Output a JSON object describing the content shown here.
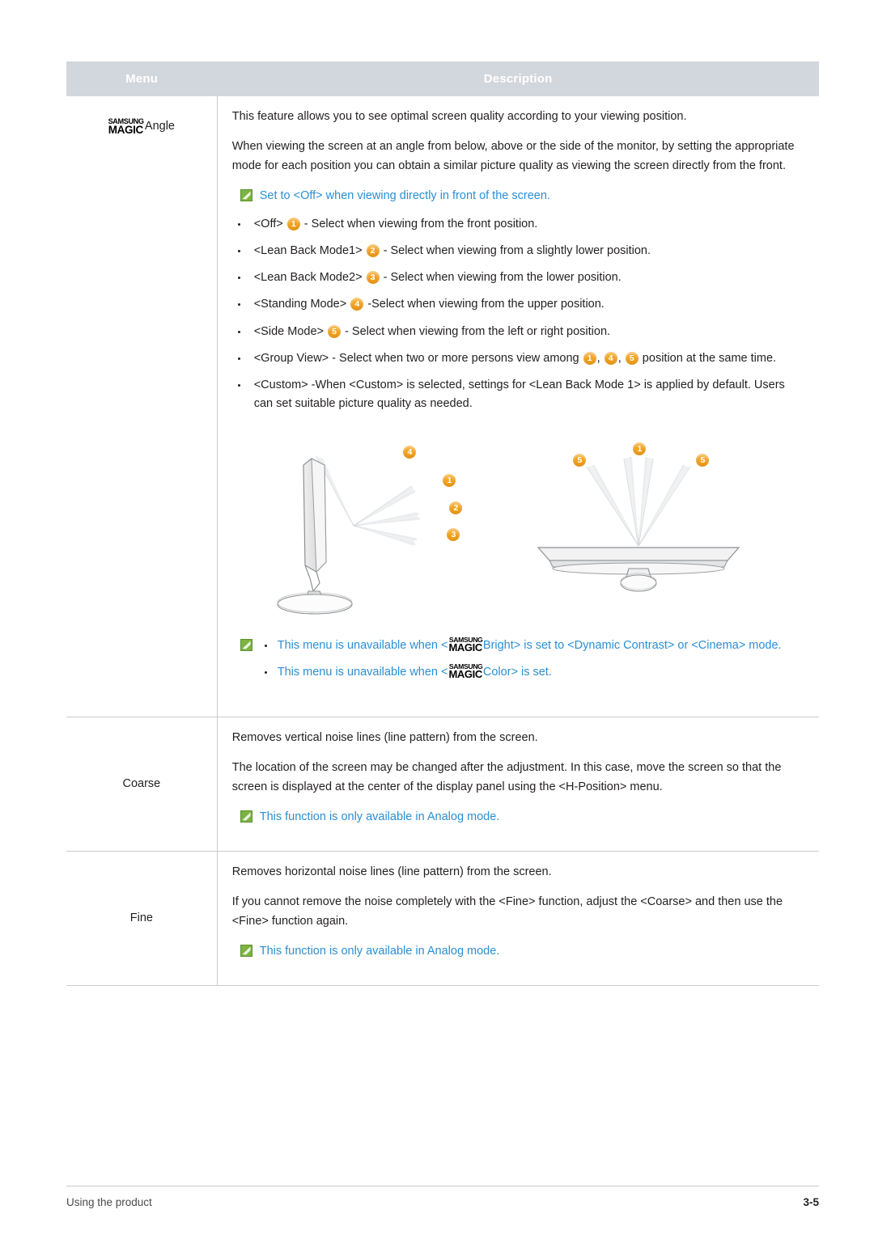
{
  "table": {
    "headers": {
      "menu": "Menu",
      "description": "Description"
    },
    "rows": [
      {
        "menu_label": "Angle",
        "menu_logo": {
          "line1": "SAMSUNG",
          "line2": "MAGIC"
        },
        "paragraphs": [
          "This feature allows you to see optimal screen quality according to your viewing position.",
          "When viewing the screen at an angle from below, above or the side of the monitor, by setting the appropriate mode for each position you can obtain a similar picture quality as viewing the screen directly from the front."
        ],
        "notice": "Set to <Off> when viewing directly in front of the screen.",
        "bullets": [
          {
            "option": "<Off>",
            "num": "1",
            "text": "- Select when viewing from the front position."
          },
          {
            "option": "<Lean Back Mode1>",
            "num": "2",
            "text": "- Select when viewing from a slightly lower position."
          },
          {
            "option": "<Lean Back Mode2>",
            "num": "3",
            "text": "- Select when viewing from the lower position."
          },
          {
            "option": "<Standing Mode>",
            "num": "4",
            "text": "-Select when viewing from the upper position."
          },
          {
            "option": "<Side Mode>",
            "num": "5",
            "text": "- Select when viewing from the left or right position."
          }
        ],
        "bullet_group_view": {
          "pre": "<Group View>  - Select when two or more persons view among ",
          "nums": [
            "1",
            "4",
            "5"
          ],
          "post": " position at the same time."
        },
        "bullet_custom": " <Custom> -When <Custom> is selected, settings for <Lean Back Mode 1> is applied by default. Users can set suitable picture quality as needed.",
        "figure_labels": {
          "left": [
            "4",
            "1",
            "2",
            "3"
          ],
          "right": [
            "5",
            "1",
            "5"
          ]
        },
        "footnotes": [
          {
            "pre": "This menu is unavailable when <",
            "logo": {
              "line1": "SAMSUNG",
              "line2": "MAGIC"
            },
            "post": "Bright> is set to <Dynamic Contrast> or <Cinema> mode."
          },
          {
            "pre": "This menu is unavailable when <",
            "logo": {
              "line1": "SAMSUNG",
              "line2": "MAGIC"
            },
            "post": "Color> is set."
          }
        ]
      },
      {
        "menu_label": "Coarse",
        "paragraphs": [
          "Removes vertical noise lines (line pattern) from the screen.",
          "The location of the screen may be changed after the adjustment. In this case, move the screen so that the screen is displayed at the center of the display panel using the <H-Position> menu."
        ],
        "notice": "This function is only available in Analog mode."
      },
      {
        "menu_label": "Fine",
        "paragraphs": [
          "Removes horizontal noise lines (line pattern) from the screen.",
          "If you cannot remove the noise completely with the <Fine> function, adjust the <Coarse> and then use the <Fine> function again."
        ],
        "notice": "This function is only available in Analog mode."
      }
    ]
  },
  "footer": {
    "left": "Using the product",
    "page": "3-5"
  },
  "colors": {
    "header_bg": "#d2d6dd",
    "link_blue": "#2a8fd4",
    "badge_orange": "#f5a623",
    "note_green": "#6aa84f"
  }
}
